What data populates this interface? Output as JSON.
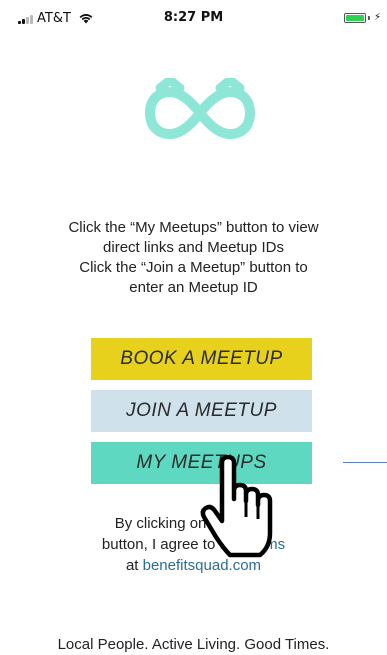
{
  "status_bar": {
    "carrier": "AT&T",
    "time": "8:27 PM",
    "battery_level": 1.0,
    "signal_bars_filled": 2,
    "signal_bars_total": 4
  },
  "logo": {
    "icon": "infinity-heart-icon",
    "color": "#8ee6d7"
  },
  "instructions": {
    "line1": "Click the “My Meetups” button to view",
    "line2": "direct links and Meetup IDs",
    "line3": "Click the “Join a Meetup” button to",
    "line4": "enter an Meetup ID"
  },
  "buttons": {
    "book": "BOOK A MEETUP",
    "join": "JOIN A MEETUP",
    "my": "MY MEETUPS"
  },
  "colors": {
    "book": "#e7d11d",
    "join": "#cfe1ea",
    "my": "#5ed8c0",
    "link": "#2a6d96"
  },
  "terms": {
    "line1": "By clicking on an above",
    "line2_prefix": "button, I agree to the ",
    "line2_link": "Terms",
    "line3_prefix": "at ",
    "line3_link": "benefitsquad.com"
  },
  "tagline": "Local People. Active Living. Good Times."
}
